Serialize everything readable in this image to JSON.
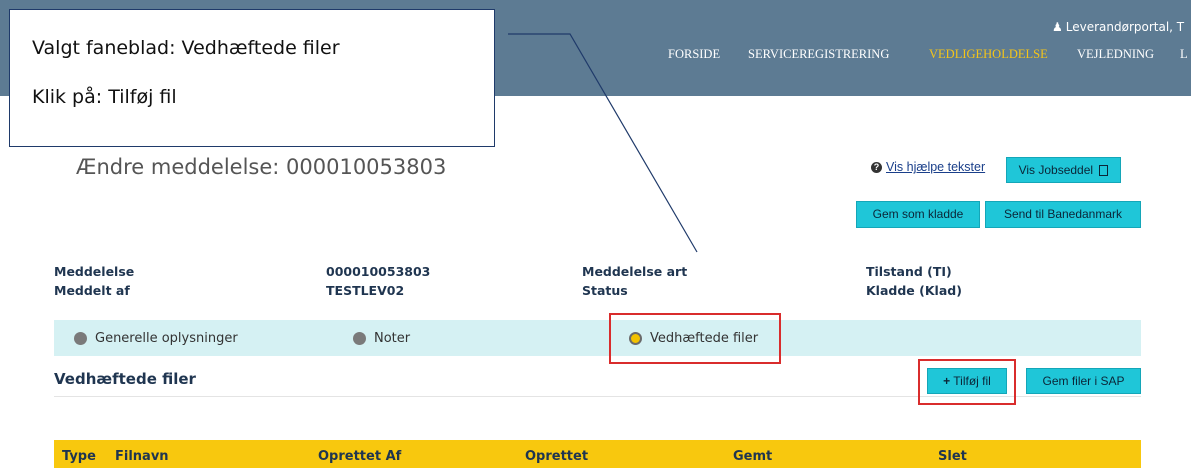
{
  "header": {
    "user_link": "Leverandørportal, T",
    "nav": [
      {
        "label": "FORSIDE"
      },
      {
        "label": "SERVICEREGISTRERING"
      },
      {
        "label": "VEDLIGEHOLDELSE"
      },
      {
        "label": "VEJLEDNING"
      },
      {
        "label": "L"
      }
    ],
    "active_color": "#f5c518",
    "bar_color": "#5d7b93"
  },
  "callout": {
    "line1": "Valgt faneblad: Vedhæftede filer",
    "line2": "Klik på: Tilføj fil"
  },
  "page": {
    "title": "Ændre meddelelse: 000010053803",
    "help_text": "Vis hjælpe tekster",
    "jobsheet_button": "Vis Jobseddel",
    "save_draft_button": "Gem som kladde",
    "send_button": "Send til Banedanmark"
  },
  "meta": {
    "rows": [
      {
        "label1": "Meddelelse",
        "value1": "000010053803",
        "label2": "Meddelelse art",
        "value2": "Tilstand (TI)"
      },
      {
        "label1": "Meddelt af",
        "value1": "TESTLEV02",
        "label2": "Status",
        "value2": "Kladde (Klad)"
      }
    ]
  },
  "tabs": [
    {
      "label": "Generelle oplysninger",
      "active": false
    },
    {
      "label": "Noter",
      "active": false
    },
    {
      "label": "Vedhæftede filer",
      "active": true
    }
  ],
  "attachments": {
    "title": "Vedhæftede filer",
    "add_button": "Tilføj fil",
    "save_sap_button": "Gem filer i SAP",
    "columns": [
      "Type",
      "Filnavn",
      "Oprettet Af",
      "Oprettet",
      "Gemt",
      "Slet"
    ],
    "header_color": "#f8c80e"
  },
  "accent_color": "#1fc6d8",
  "highlight_color": "#d92c2c"
}
